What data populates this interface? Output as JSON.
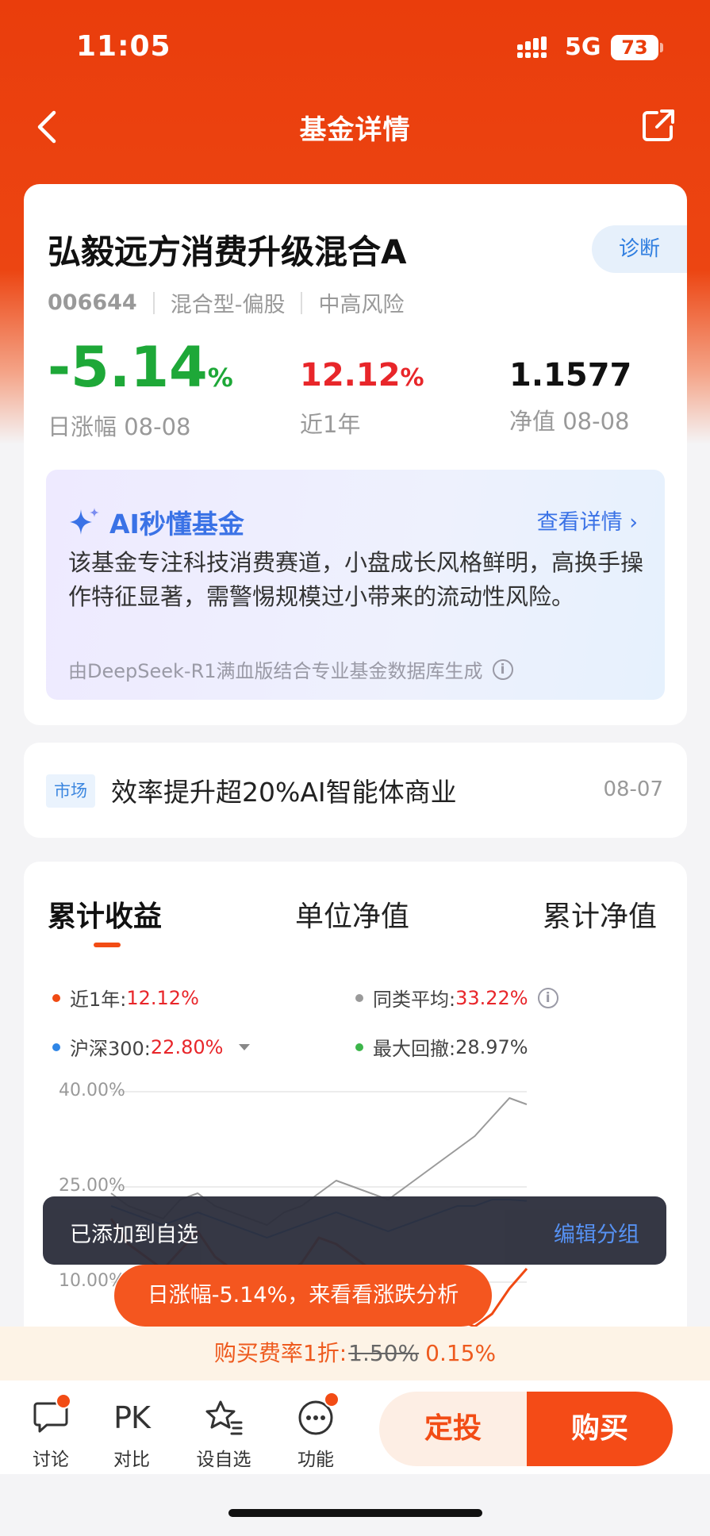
{
  "status_bar": {
    "time": "11:05",
    "network": "5G",
    "battery": "73"
  },
  "nav": {
    "title": "基金详情"
  },
  "fund": {
    "name": "弘毅远方消费升级混合A",
    "diagnose_label": "诊断",
    "code": "006644",
    "category": "混合型-偏股",
    "risk": "中高风险",
    "daily_change": "-5.14",
    "daily_change_unit": "%",
    "daily_label": "日涨幅 08-08",
    "year_return": "12.12",
    "year_return_unit": "%",
    "year_label": "近1年",
    "nav_value": "1.1577",
    "nav_label": "净值 08-08"
  },
  "ai": {
    "title": "AI秒懂基金",
    "more": "查看详情 ›",
    "text": "该基金专注科技消费赛道，小盘成长风格鲜明，高换手操作特征显著，需警惕规模过小带来的流动性风险。",
    "footer": "由DeepSeek-R1满血版结合专业基金数据库生成"
  },
  "news": {
    "tag": "市场",
    "headline": "效率提升超20%AI智能体商业",
    "date": "08-07"
  },
  "chart": {
    "tabs": [
      "累计收益",
      "单位净值",
      "累计净值"
    ],
    "legend": [
      {
        "label": "近1年:",
        "value": "12.12%",
        "color": "#f04a13"
      },
      {
        "label": "同类平均:",
        "value": "33.22%",
        "color": "#9a9a9a"
      },
      {
        "label": "沪深300:",
        "value": "22.80%",
        "color": "#2f86e6"
      },
      {
        "label": "最大回撤:",
        "value": "28.97%",
        "color": "#3cb54a"
      }
    ],
    "y_ticks": [
      "40.00%",
      "25.00%",
      "10.00%"
    ]
  },
  "chart_data": {
    "type": "line",
    "ylim": [
      0,
      40
    ],
    "y_ticks": [
      "40.00%",
      "25.00%",
      "10.00%"
    ],
    "series": [
      {
        "name": "同类平均",
        "color": "#9a9a9a",
        "values": [
          24,
          22,
          21,
          20,
          23,
          24,
          22,
          21,
          20,
          19,
          21,
          22,
          24,
          26,
          25,
          24,
          23,
          25,
          27,
          29,
          31,
          33,
          36,
          39,
          38
        ]
      },
      {
        "name": "沪深300",
        "color": "#2f86e6",
        "values": [
          22,
          21,
          20,
          19,
          20,
          21,
          20,
          19,
          18,
          17,
          18,
          19,
          20,
          21,
          20,
          19,
          18,
          19,
          20,
          21,
          22,
          22,
          23,
          23,
          22.8
        ]
      },
      {
        "name": "近1年",
        "color": "#f04a13",
        "values": [
          20,
          16,
          14,
          12,
          15,
          18,
          14,
          12,
          10,
          8,
          11,
          13,
          17,
          16,
          14,
          12,
          10,
          8,
          6,
          5,
          4,
          3,
          5,
          9,
          12.12
        ]
      }
    ]
  },
  "toast": {
    "message": "已添加到自选",
    "action": "编辑分组"
  },
  "promo_pill": {
    "text": "日涨幅-5.14%，来看看涨跌分析"
  },
  "fee_bar": {
    "prefix": "购买费率1折:",
    "original": "1.50%",
    "current": "0.15%"
  },
  "bottom_bar": {
    "discuss": "讨论",
    "pk_icon_text": "PK",
    "compare": "对比",
    "watchlist": "设自选",
    "functions": "功能",
    "invest": "定投",
    "buy": "购买"
  }
}
